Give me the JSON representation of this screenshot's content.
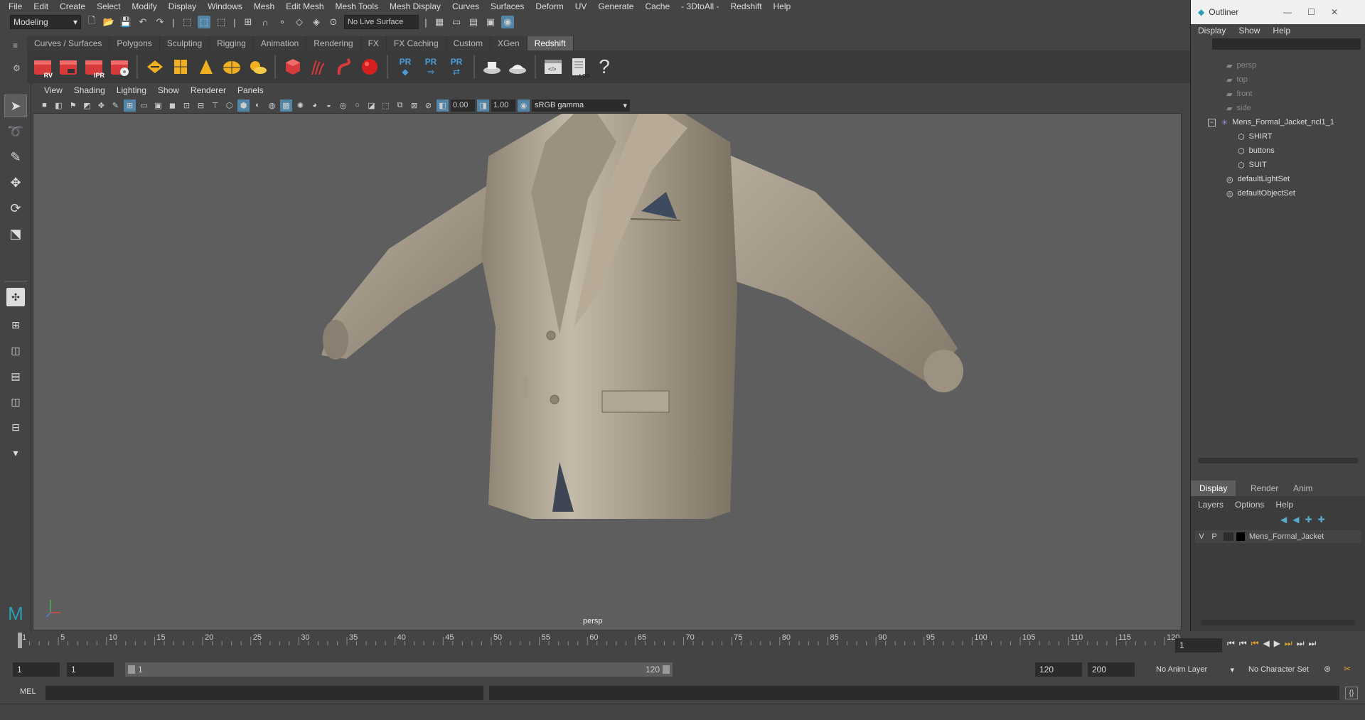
{
  "menubar": {
    "items": [
      "File",
      "Edit",
      "Create",
      "Select",
      "Modify",
      "Display",
      "Windows",
      "Mesh",
      "Edit Mesh",
      "Mesh Tools",
      "Mesh Display",
      "Curves",
      "Surfaces",
      "Deform",
      "UV",
      "Generate",
      "Cache",
      "- 3DtoAll -",
      "Redshift",
      "Help"
    ]
  },
  "statusline": {
    "mode": "Modeling",
    "live_surface": "No Live Surface"
  },
  "shelf": {
    "tabs": [
      "Curves / Surfaces",
      "Polygons",
      "Sculpting",
      "Rigging",
      "Animation",
      "Rendering",
      "FX",
      "FX Caching",
      "Custom",
      "XGen",
      "Redshift"
    ],
    "active_tab": "Redshift",
    "icon_labels": {
      "rv": "RV",
      "ipr": "IPR",
      "pr": "PR",
      "log": ".LOG",
      "help": "?"
    }
  },
  "viewport": {
    "menu": [
      "View",
      "Shading",
      "Lighting",
      "Show",
      "Renderer",
      "Panels"
    ],
    "exposure": "0.00",
    "gamma_value": "1.00",
    "color_space": "sRGB gamma",
    "camera": "persp"
  },
  "outliner": {
    "title": "Outliner",
    "menu": [
      "Display",
      "Show",
      "Help"
    ],
    "cameras": [
      "persp",
      "top",
      "front",
      "side"
    ],
    "group": "Mens_Formal_Jacket_ncl1_1",
    "children": [
      "SHIRT",
      "buttons",
      "SUIT"
    ],
    "sets": [
      "defaultLightSet",
      "defaultObjectSet"
    ]
  },
  "layer_editor": {
    "tabs": [
      "Display",
      "Render",
      "Anim"
    ],
    "active_tab": "Display",
    "menu": [
      "Layers",
      "Options",
      "Help"
    ],
    "layer": {
      "v": "V",
      "p": "P",
      "name": "Mens_Formal_Jacket"
    }
  },
  "timeline": {
    "ticks": [
      "1",
      "5",
      "10",
      "15",
      "20",
      "25",
      "30",
      "35",
      "40",
      "45",
      "50",
      "55",
      "60",
      "65",
      "70",
      "75",
      "80",
      "85",
      "90",
      "95",
      "100",
      "105",
      "110",
      "115",
      "120"
    ],
    "current_frame": "1",
    "range_start": "1",
    "playback_start": "1",
    "slider_start": "1",
    "slider_end": "120",
    "playback_end": "120",
    "range_end": "200",
    "anim_layer": "No Anim Layer",
    "character_set": "No Character Set"
  },
  "command": {
    "label": "MEL"
  },
  "colors": {
    "accent": "#5285a6",
    "redshift_red": "#d63a3a",
    "jacket": "#b3a898",
    "viewport_bg": "#5e5e5e"
  }
}
